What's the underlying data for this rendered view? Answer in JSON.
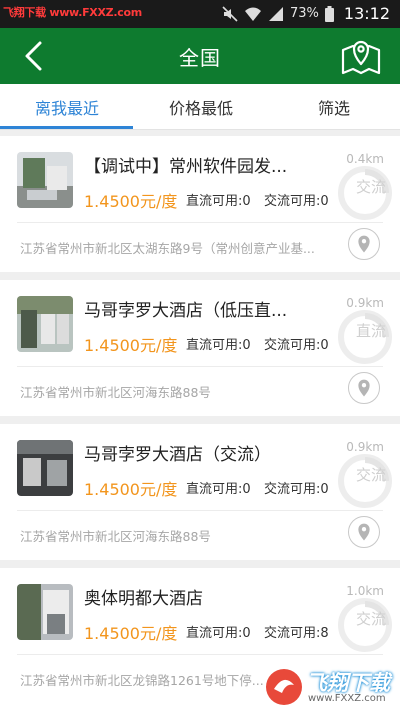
{
  "status_bar": {
    "watermark": "飞翔下载 www.FXXZ.com",
    "battery": "73%",
    "time": "13:12"
  },
  "header": {
    "title": "全国",
    "back_icon": "chevron-left-icon",
    "map_icon": "map-pin-icon"
  },
  "tabs": [
    {
      "label": "离我最近",
      "active": true
    },
    {
      "label": "价格最低",
      "active": false
    },
    {
      "label": "筛选",
      "active": false
    }
  ],
  "stations": [
    {
      "name": "【调试中】常州软件园发...",
      "price": "1.4500元/度",
      "dc_label": "直流可用:",
      "dc": "0",
      "ac_label": "交流可用:",
      "ac": "0",
      "distance": "0.4km",
      "type": "交流",
      "address": "江苏省常州市新北区太湖东路9号（常州创意产业基..."
    },
    {
      "name": "马哥孛罗大酒店（低压直...",
      "price": "1.4500元/度",
      "dc_label": "直流可用:",
      "dc": "0",
      "ac_label": "交流可用:",
      "ac": "0",
      "distance": "0.9km",
      "type": "直流",
      "address": "江苏省常州市新北区河海东路88号"
    },
    {
      "name": "马哥孛罗大酒店（交流）",
      "price": "1.4500元/度",
      "dc_label": "直流可用:",
      "dc": "0",
      "ac_label": "交流可用:",
      "ac": "0",
      "distance": "0.9km",
      "type": "交流",
      "address": "江苏省常州市新北区河海东路88号"
    },
    {
      "name": "奥体明都大酒店",
      "price": "1.4500元/度",
      "dc_label": "直流可用:",
      "dc": "0",
      "ac_label": "交流可用:",
      "ac": "8",
      "distance": "1.0km",
      "type": "交流",
      "address": "江苏省常州市新北区龙锦路1261号地下停..."
    }
  ],
  "watermark_br": {
    "brand": "飞翔下载",
    "url": "www.FXXZ.com"
  },
  "colors": {
    "appbar": "#0e7b2f",
    "accent_tab": "#2e84d6",
    "price": "#f2951d"
  }
}
